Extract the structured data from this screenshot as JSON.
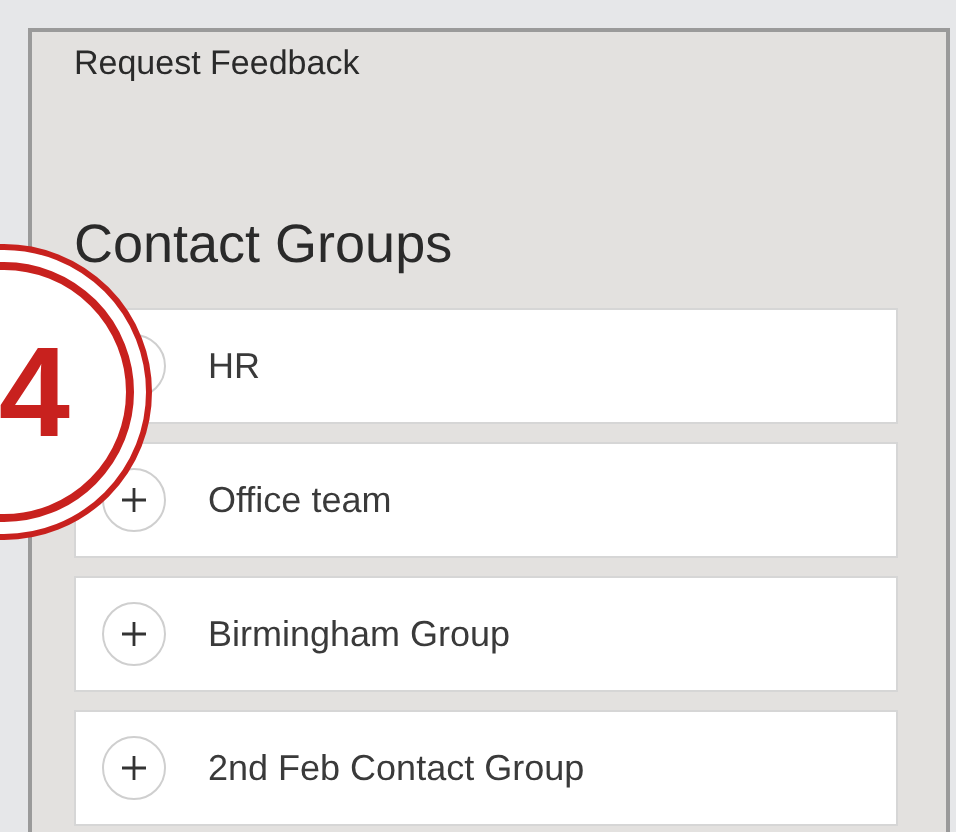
{
  "header": {
    "title": "Request Feedback"
  },
  "section": {
    "title": "Contact Groups"
  },
  "groups": [
    {
      "label": "HR"
    },
    {
      "label": "Office team"
    },
    {
      "label": "Birmingham Group"
    },
    {
      "label": "2nd Feb Contact Group"
    }
  ],
  "callout": {
    "number": "4"
  }
}
